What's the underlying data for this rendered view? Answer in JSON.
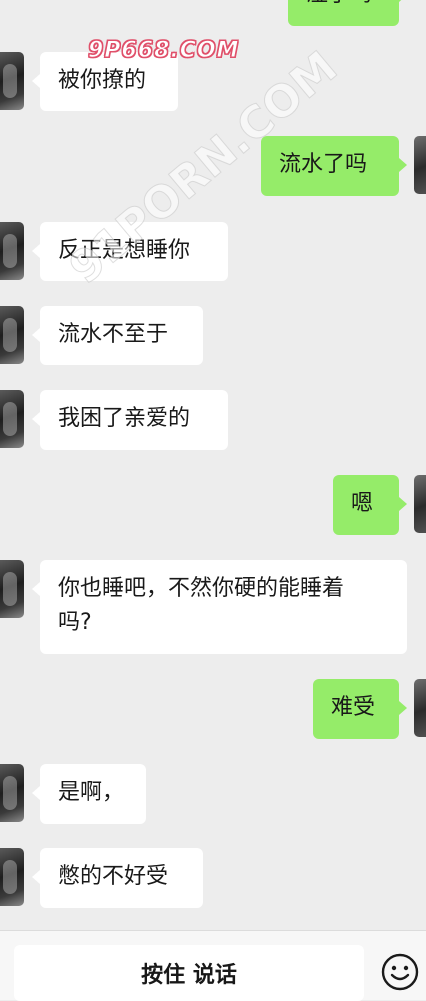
{
  "watermark": {
    "top": "9P668.COM",
    "diagonal": "91PORN.COM"
  },
  "messages": [
    {
      "side": "right",
      "text": "湿了吗"
    },
    {
      "side": "left",
      "text": "被你撩的"
    },
    {
      "side": "right",
      "text": "流水了吗"
    },
    {
      "side": "left",
      "text": "反正是想睡你"
    },
    {
      "side": "left",
      "text": "流水不至于"
    },
    {
      "side": "left",
      "text": "我困了亲爱的"
    },
    {
      "side": "right",
      "text": "嗯"
    },
    {
      "side": "left",
      "text": "你也睡吧，不然你硬的能睡着\n吗?"
    },
    {
      "side": "right",
      "text": "难受"
    },
    {
      "side": "left",
      "text": "是啊，"
    },
    {
      "side": "left",
      "text": "憋的不好受"
    }
  ],
  "input_bar": {
    "hold_to_talk": "按住 说话",
    "emoji_icon": "smiley-face-icon"
  },
  "colors": {
    "background": "#ededed",
    "sent_bubble": "#95ec69",
    "received_bubble": "#ffffff",
    "input_bar": "#f7f7f7"
  }
}
